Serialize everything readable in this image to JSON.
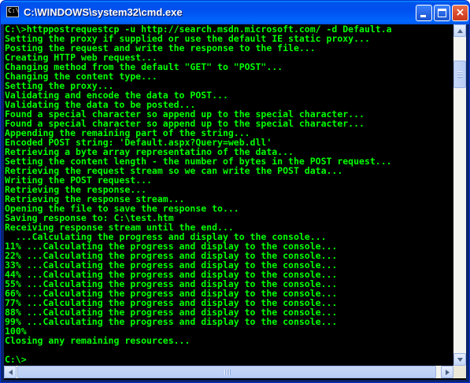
{
  "window": {
    "title": "C:\\WINDOWS\\system32\\cmd.exe",
    "icon": "cmd-icon"
  },
  "titlebar": {
    "minimize_icon": "minimize-icon",
    "maximize_icon": "maximize-icon",
    "close_icon": "close-icon",
    "close_glyph": "×",
    "icon_prompt": "C:\\"
  },
  "console": {
    "text_color": "#00ff00",
    "background": "#000000",
    "lines": [
      "C:\\>httppostrequestcp -u http://search.msdn.microsoft.com/ -d Default.a",
      "Setting the proxy if supplied or use the default IE static proxy...",
      "Posting the request and write the response to the file...",
      "Creating HTTP web request...",
      "Changing method from the default \"GET\" to \"POST\"...",
      "Changing the content type...",
      "Setting the proxy...",
      "Validating and encode the data to POST...",
      "Validating the data to be posted...",
      "Found a special character so append up to the special character...",
      "Found a special character so append up to the special character...",
      "Appending the remaining part of the string...",
      "Encoded POST string: 'Default.aspx?Query=web.dll'",
      "Retrieving a byte array representatino of the data...",
      "Setting the content length - the number of bytes in the POST request...",
      "Retrieving the request stream so we can write the POST data...",
      "Writing the POST request...",
      "Retrieving the response...",
      "Retrieving the response stream...",
      "Opening the file to save the response to...",
      "Saving response to: C:\\test.htm",
      "Receiving response stream until the end...",
      "  ...Calculating the progress and display to the console...",
      "11% ...Calculating the progress and display to the console...",
      "22% ...Calculating the progress and display to the console...",
      "33% ...Calculating the progress and display to the console...",
      "44% ...Calculating the progress and display to the console...",
      "55% ...Calculating the progress and display to the console...",
      "66% ...Calculating the progress and display to the console...",
      "77% ...Calculating the progress and display to the console...",
      "88% ...Calculating the progress and display to the console...",
      "99% ...Calculating the progress and display to the console...",
      "100%",
      "Closing any remaining resources...",
      "",
      "C:\\>"
    ]
  },
  "scrollbars": {
    "vertical": {
      "up_icon": "scroll-up-arrow-icon",
      "down_icon": "scroll-down-arrow-icon",
      "position": 0.08
    },
    "horizontal": {
      "left_icon": "scroll-left-arrow-icon",
      "right_icon": "scroll-right-arrow-icon",
      "position": 0
    }
  }
}
